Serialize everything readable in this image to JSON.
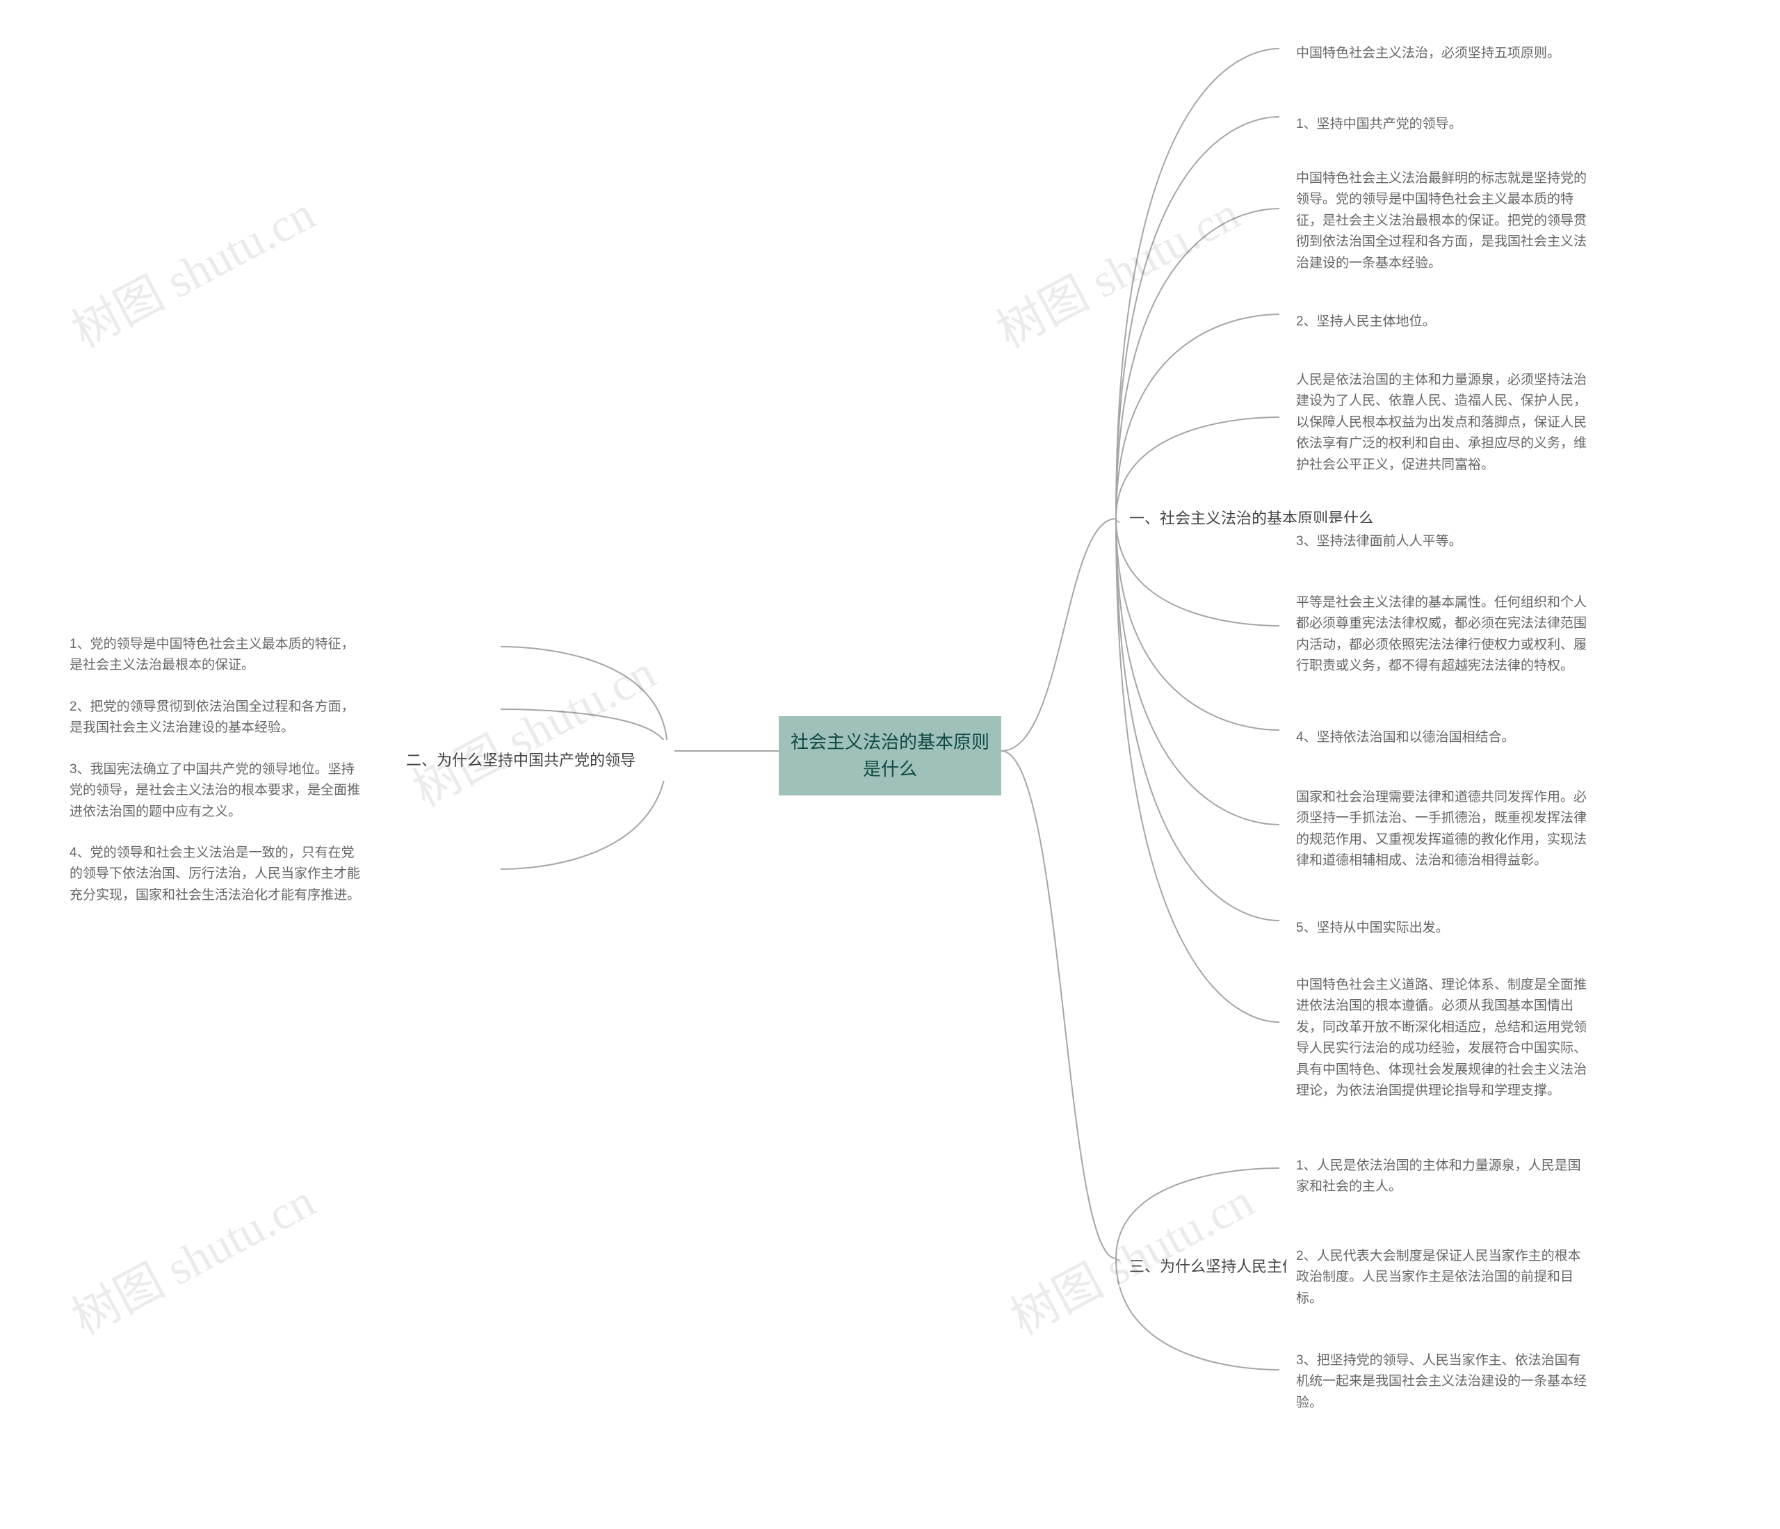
{
  "root": {
    "title": "社会主义法治的基本原则是什么"
  },
  "section1": {
    "title": "一、社会主义法治的基本原则是什么",
    "items": [
      "中国特色社会主义法治，必须坚持五项原则。",
      "1、坚持中国共产党的领导。",
      "中国特色社会主义法治最鲜明的标志就是坚持党的领导。党的领导是中国特色社会主义最本质的特征，是社会主义法治最根本的保证。把党的领导贯彻到依法治国全过程和各方面，是我国社会主义法治建设的一条基本经验。",
      "2、坚持人民主体地位。",
      "人民是依法治国的主体和力量源泉，必须坚持法治建设为了人民、依靠人民、造福人民、保护人民，以保障人民根本权益为出发点和落脚点，保证人民依法享有广泛的权利和自由、承担应尽的义务，维护社会公平正义，促进共同富裕。",
      "3、坚持法律面前人人平等。",
      "平等是社会主义法律的基本属性。任何组织和个人都必须尊重宪法法律权威，都必须在宪法法律范围内活动，都必须依照宪法法律行使权力或权利、履行职责或义务，都不得有超越宪法法律的特权。",
      "4、坚持依法治国和以德治国相结合。",
      "国家和社会治理需要法律和道德共同发挥作用。必须坚持一手抓法治、一手抓德治，既重视发挥法律的规范作用、又重视发挥道德的教化作用，实现法律和道德相辅相成、法治和德治相得益彰。",
      "5、坚持从中国实际出发。",
      "中国特色社会主义道路、理论体系、制度是全面推进依法治国的根本遵循。必须从我国基本国情出发，同改革开放不断深化相适应，总结和运用党领导人民实行法治的成功经验，发展符合中国实际、具有中国特色、体现社会发展规律的社会主义法治理论，为依法治国提供理论指导和学理支撑。"
    ]
  },
  "section2": {
    "title": "二、为什么坚持中国共产党的领导",
    "items": [
      "1、党的领导是中国特色社会主义最本质的特征，是社会主义法治最根本的保证。",
      "2、把党的领导贯彻到依法治国全过程和各方面，是我国社会主义法治建设的基本经验。",
      "3、我国宪法确立了中国共产党的领导地位。坚持党的领导，是社会主义法治的根本要求，是全面推进依法治国的题中应有之义。",
      "4、党的领导和社会主义法治是一致的，只有在党的领导下依法治国、厉行法治，人民当家作主才能充分实现，国家和社会生活法治化才能有序推进。"
    ]
  },
  "section3": {
    "title": "三、为什么坚持人民主体地位",
    "items": [
      "1、人民是依法治国的主体和力量源泉，人民是国家和社会的主人。",
      "2、人民代表大会制度是保证人民当家作主的根本政治制度。人民当家作主是依法治国的前提和目标。",
      "3、把坚持党的领导、人民当家作主、依法治国有机统一起来是我国社会主义法治建设的一条基本经验。"
    ]
  },
  "watermark": "树图 shutu.cn"
}
